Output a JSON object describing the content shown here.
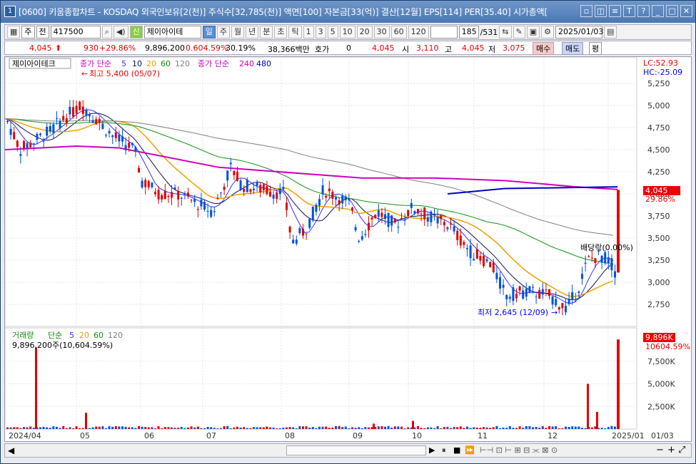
{
  "window": {
    "number": "1",
    "title": "[0600] 키움종합차트 - KOSDAQ 외국인보유[2(천)] 주식수[32,785(천)] 액면[100] 자본금[33(억)] 결산[12월] EPS[114] PER[35.40] 시가총액["
  },
  "toolbar": {
    "type_btn": "주",
    "prev_btn": "전",
    "code": "417500",
    "stock_name": "제이아이테",
    "periods": [
      "일",
      "주",
      "월",
      "년",
      "분",
      "초",
      "틱"
    ],
    "intervals": [
      "1",
      "3",
      "5",
      "10",
      "20",
      "30",
      "60",
      "120"
    ],
    "count": "185",
    "total": "/531",
    "date": "2025/01/03"
  },
  "quote": {
    "price": "4,045",
    "change": "930",
    "change_pct": "+29.86%",
    "volume": "9,896,200",
    "vol_ratio": "0.604.59%",
    "turnover": "30.19%",
    "amount": "38,366백만",
    "hoga_label": "호가",
    "hoga_val": "0",
    "hoga_price": "4,045",
    "open_label": "시",
    "open": "3,110",
    "high_label": "고",
    "high": "4,045",
    "low_label": "저",
    "low": "3,075",
    "buy": "매수",
    "sell": "매도",
    "avg": "평"
  },
  "price_panel": {
    "stock_label": "제이아이테크",
    "ma_label": "종가 단순",
    "ma": [
      "5",
      "10",
      "20",
      "60",
      "120"
    ],
    "ma2_label": "종가 단순",
    "ma2": [
      "240",
      "480"
    ],
    "lc": "LC:52.93",
    "hc": "HC:-25.09",
    "high_note": "최고 5,400 (05/07)",
    "low_note": "최저 2,645 (12/09)",
    "ex_note": "배당락(0.00%)",
    "cur_price": "4,045",
    "cur_pct": "29.86%",
    "yticks": [
      "5,250",
      "5,000",
      "4,750",
      "4,500",
      "4,250",
      "4,000",
      "3,750",
      "3,500",
      "3,250",
      "3,000",
      "2,750"
    ]
  },
  "volume_panel": {
    "label": "거래량",
    "ma_label": "단순",
    "ma": [
      "5",
      "20",
      "60",
      "120"
    ],
    "value": "9,896,200주(10,604.59%)",
    "cur": "9,896K",
    "cur_pct": "10604.59%",
    "yticks": [
      "7,500K",
      "5,000K",
      "2,500K"
    ]
  },
  "xaxis": {
    "labels": [
      "2024/04",
      "05",
      "06",
      "07",
      "08",
      "09",
      "10",
      "11",
      "12",
      "2025/01",
      "01/03"
    ]
  },
  "colors": {
    "up": "#e00000",
    "down": "#0050e0",
    "ma5": "#3030ff",
    "ma10": "#101060",
    "ma20": "#f0a000",
    "ma60": "#109010",
    "ma120": "#808080",
    "ma240": "#d000c0",
    "ma480": "#0000c0"
  }
}
